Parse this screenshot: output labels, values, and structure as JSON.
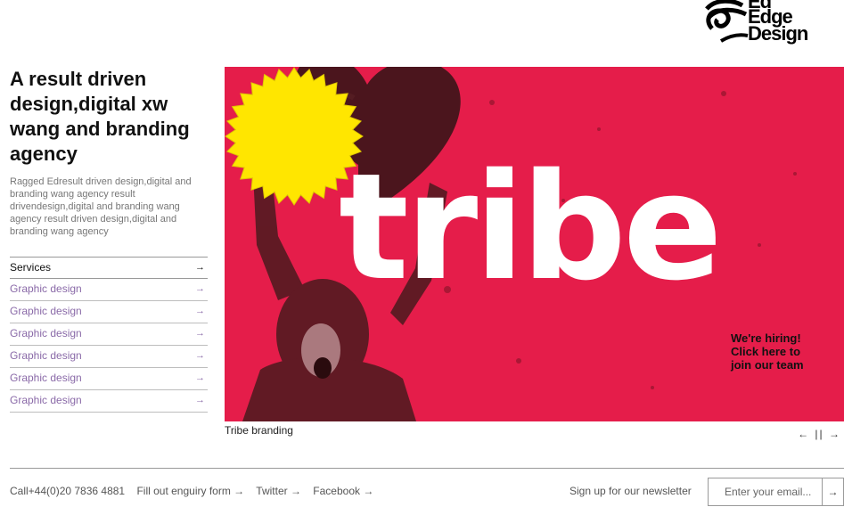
{
  "logo": {
    "line1": "Ed",
    "line2": "Edge",
    "line3": "Design"
  },
  "headline": "A result driven design,digital xw wang and branding agency",
  "intro": "Ragged Edresult driven design,digital and branding wang agency result drivendesign,digital and branding wang agency result driven design,digital and branding wang agency",
  "services": {
    "header": {
      "label": "Services",
      "arrow": "→"
    },
    "items": [
      {
        "label": "Graphic design",
        "arrow": "→"
      },
      {
        "label": "Graphic design",
        "arrow": "→"
      },
      {
        "label": "Graphic design",
        "arrow": "→"
      },
      {
        "label": "Graphic design",
        "arrow": "→"
      },
      {
        "label": "Graphic design",
        "arrow": "→"
      },
      {
        "label": "Graphic design",
        "arrow": "→"
      }
    ]
  },
  "hero": {
    "word": "tribe",
    "burst_line1": "We're hiring!",
    "burst_line2": "Click here to",
    "burst_line3": "join our team",
    "caption": "Tribe branding",
    "colors": {
      "background": "#e51d4a",
      "burst": "#ffe600"
    }
  },
  "pager": {
    "prev": "←",
    "pause": "||",
    "next": "→"
  },
  "footer": {
    "phone": "Call+44(0)20 7836 4881",
    "enquiry": "Fill out enguiry form →",
    "twitter": "Twitter →",
    "facebook": "Facebook →",
    "newsletter_label": "Sign up for our newsletter",
    "email_placeholder": "Enter your email...",
    "submit": "→"
  }
}
